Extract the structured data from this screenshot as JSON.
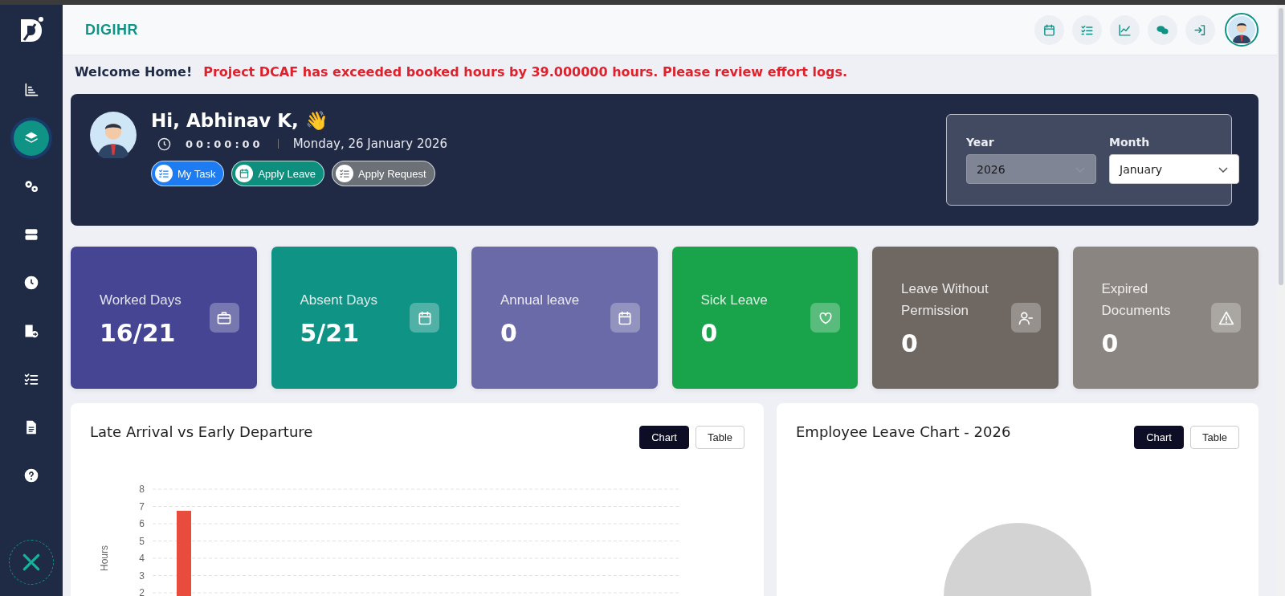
{
  "sidebar": {
    "items": [
      {
        "kind": "bar-chart",
        "selected": false
      },
      {
        "kind": "layers",
        "selected": true
      },
      {
        "kind": "gears",
        "selected": false
      },
      {
        "kind": "server",
        "selected": false
      },
      {
        "kind": "clock",
        "selected": false
      },
      {
        "kind": "building",
        "selected": false
      },
      {
        "kind": "checklist",
        "selected": false
      },
      {
        "kind": "document",
        "selected": false
      },
      {
        "kind": "help",
        "selected": false
      }
    ]
  },
  "header": {
    "brand": "DIGIHR",
    "actions": [
      {
        "kind": "calendar"
      },
      {
        "kind": "checklist"
      },
      {
        "kind": "line-chart"
      },
      {
        "kind": "chat"
      },
      {
        "kind": "login"
      }
    ]
  },
  "notice": {
    "welcome": "Welcome Home!",
    "alert": "Project DCAF has exceeded booked hours by 39.000000 hours. Please review effort logs."
  },
  "banner": {
    "greeting": "Hi, Abhinav K, 👋",
    "timer": "00:00:00",
    "date": "Monday, 26 January 2026",
    "buttons": [
      {
        "label": "My Task",
        "kind": "checklist",
        "color": "#1e7cf2"
      },
      {
        "label": "Apply Leave",
        "kind": "calendar",
        "color": "#0e8f7e"
      },
      {
        "label": "Apply Request",
        "kind": "checklist",
        "color": "#6c7178"
      }
    ],
    "filters": [
      {
        "label": "Year",
        "value": "2026",
        "disabled": true
      },
      {
        "label": "Month",
        "value": "January",
        "disabled": false
      }
    ]
  },
  "cards": [
    {
      "label": "Worked Days",
      "value": "16/21",
      "kind": "briefcase",
      "color": "#454593"
    },
    {
      "label": "Absent Days",
      "value": "5/21",
      "kind": "calendar",
      "color": "#0e9385"
    },
    {
      "label": "Annual leave",
      "value": "0",
      "kind": "calendar",
      "color": "#6a6aa8"
    },
    {
      "label": "Sick Leave",
      "value": "0",
      "kind": "heart",
      "color": "#19a34a"
    },
    {
      "label": "Leave Without Permission",
      "value": "0",
      "kind": "user-minus",
      "color": "#6e6762"
    },
    {
      "label": "Expired Documents",
      "value": "0",
      "kind": "warning",
      "color": "#8a8580"
    }
  ],
  "panels": [
    {
      "title": "Late Arrival vs Early Departure",
      "toggles": [
        {
          "label": "Chart",
          "selected": true
        },
        {
          "label": "Table",
          "selected": false
        }
      ],
      "chart_data": {
        "type": "bar",
        "ylabel": "Hours",
        "ylim": [
          2,
          8
        ],
        "grid": true,
        "yticks": [
          2,
          3,
          4,
          5,
          6,
          7,
          8
        ],
        "series": [
          {
            "color": "#e74c3c",
            "values": [
              6.75
            ]
          }
        ]
      }
    },
    {
      "title": "Employee Leave Chart - 2026",
      "toggles": [
        {
          "label": "Chart",
          "selected": true
        },
        {
          "label": "Table",
          "selected": false
        }
      ]
    }
  ]
}
